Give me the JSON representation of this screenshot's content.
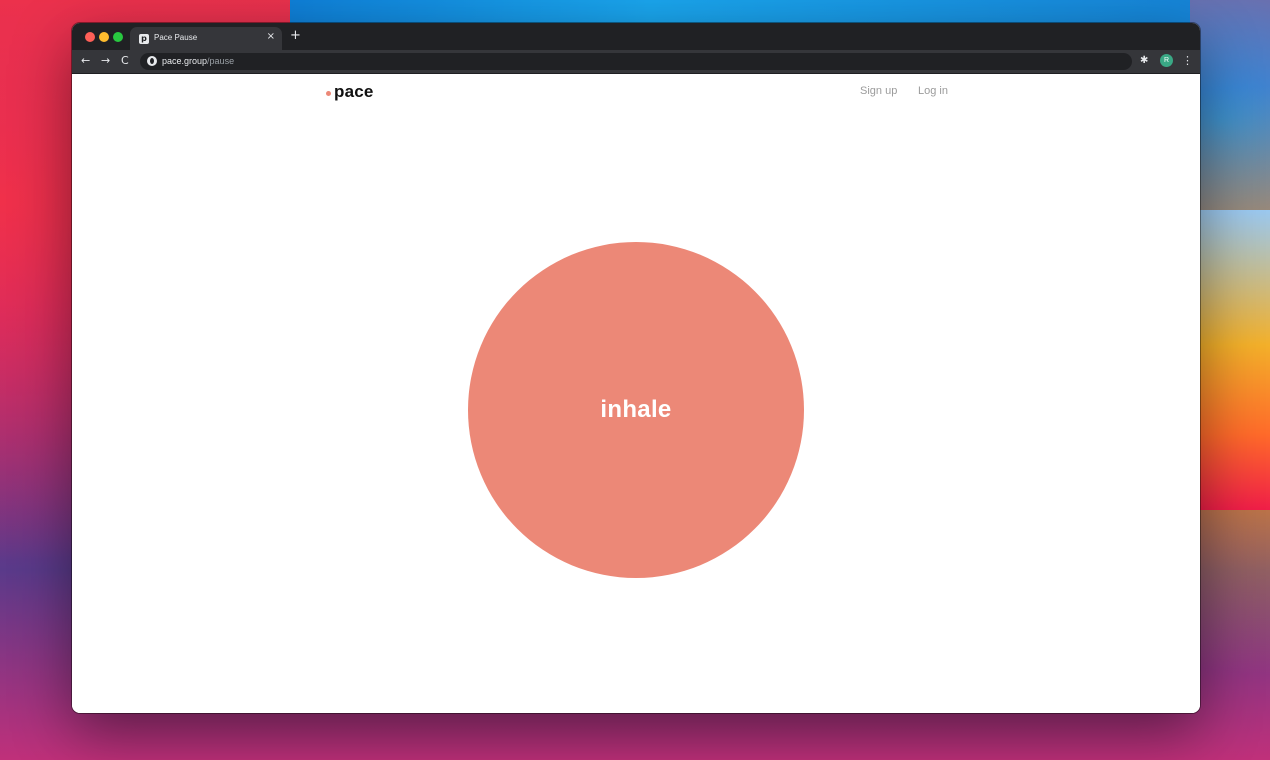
{
  "browser": {
    "tab": {
      "favicon": "p",
      "title": "Pace Pause",
      "close": "×"
    },
    "new_tab": "+",
    "nav": {
      "back": "←",
      "forward": "→",
      "reload": "C"
    },
    "url": {
      "host": "pace.group",
      "path": "/pause"
    },
    "extensions_icon": "puzzle-icon",
    "profile_initial": "R",
    "menu": "⋮"
  },
  "site": {
    "logo": "pace",
    "nav": {
      "signup": "Sign up",
      "login": "Log in"
    }
  },
  "breath": {
    "label": "inhale",
    "color": "#ec8877"
  }
}
